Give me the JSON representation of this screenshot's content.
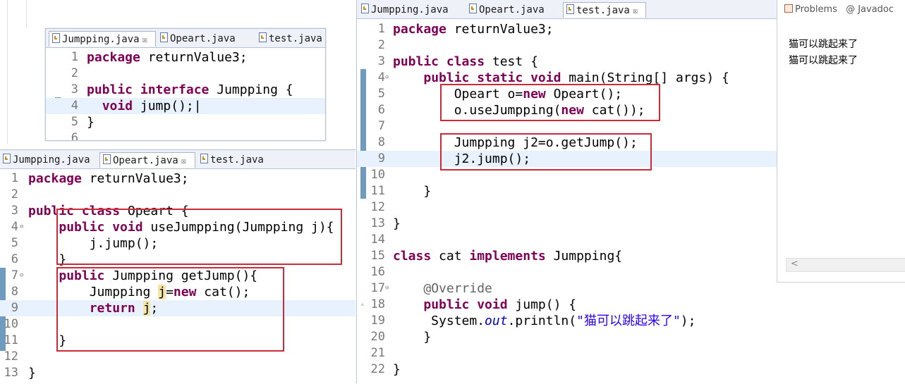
{
  "top_left_editor": {
    "tabs": [
      {
        "label": "Jumpping.java",
        "active": true,
        "close": "☒"
      },
      {
        "label": "Opeart.java",
        "active": false
      },
      {
        "label": "test.java",
        "active": false
      }
    ],
    "lines": [
      {
        "n": "1",
        "h": "<span class=\"kw\">package</span> returnValue3;"
      },
      {
        "n": "2",
        "h": ""
      },
      {
        "n": "3",
        "h": "<span class=\"kw\">public interface</span> Jumpping {"
      },
      {
        "n": "4",
        "h": "  <span class=\"kw\">void</span> jump();|"
      },
      {
        "n": "5",
        "h": "}"
      },
      {
        "n": "6",
        "h": ""
      }
    ]
  },
  "bottom_left_editor": {
    "tabs": [
      {
        "label": "Jumpping.java",
        "active": false
      },
      {
        "label": "Opeart.java",
        "active": true,
        "close": "☒"
      },
      {
        "label": "test.java",
        "active": false
      }
    ],
    "lines": [
      {
        "n": "1",
        "h": "<span class=\"kw\">package</span> returnValue3;"
      },
      {
        "n": "2",
        "h": ""
      },
      {
        "n": "3",
        "h": "<span class=\"kw\">public class</span> Opeart {"
      },
      {
        "n": "4",
        "h": "    <span class=\"kw\">public void</span> useJumpping(Jumpping j){"
      },
      {
        "n": "5",
        "h": "        j.jump();"
      },
      {
        "n": "6",
        "h": "    }"
      },
      {
        "n": "7",
        "h": "    <span class=\"kw\">public</span> Jumpping getJump(){"
      },
      {
        "n": "8",
        "h": "        Jumpping <span class=\"mark\">j</span>=<span class=\"kw\">new</span> cat();"
      },
      {
        "n": "9",
        "h": "        <span class=\"kw\">return</span> <span class=\"mark\">j</span>;"
      },
      {
        "n": "10",
        "h": ""
      },
      {
        "n": "11",
        "h": "    }"
      },
      {
        "n": "12",
        "h": ""
      },
      {
        "n": "13",
        "h": "}"
      }
    ]
  },
  "right_editor": {
    "tabs": [
      {
        "label": "Jumpping.java",
        "active": false
      },
      {
        "label": "Opeart.java",
        "active": false
      },
      {
        "label": "test.java",
        "active": true,
        "close": "☒"
      }
    ],
    "lines": [
      {
        "n": "1",
        "h": "<span class=\"kw\">package</span> returnValue3;"
      },
      {
        "n": "2",
        "h": ""
      },
      {
        "n": "3",
        "h": "<span class=\"kw\">public class</span> test {"
      },
      {
        "n": "4",
        "h": "    <span class=\"kw\">public static void</span> main(String[] args) {"
      },
      {
        "n": "5",
        "h": "        Opeart o=<span class=\"kw\">new</span> Opeart();"
      },
      {
        "n": "6",
        "h": "        o.useJumpping(<span class=\"kw\">new</span> cat());"
      },
      {
        "n": "7",
        "h": ""
      },
      {
        "n": "8",
        "h": "        Jumpping j2=o.getJump();"
      },
      {
        "n": "9",
        "h": "        j2.jump();"
      },
      {
        "n": "10",
        "h": ""
      },
      {
        "n": "11",
        "h": "    }"
      },
      {
        "n": "12",
        "h": ""
      },
      {
        "n": "13",
        "h": "}"
      },
      {
        "n": "14",
        "h": ""
      },
      {
        "n": "15",
        "h": "<span class=\"kw\">class</span> cat <span class=\"kw\">implements</span> Jumpping{"
      },
      {
        "n": "16",
        "h": ""
      },
      {
        "n": "17",
        "h": "    <span class=\"ann\">@Override</span>"
      },
      {
        "n": "18",
        "h": "    <span class=\"kw\">public void</span> jump() {"
      },
      {
        "n": "19",
        "h": "     System.<span class=\"it\">out</span>.println(<span class=\"str\">\"猫可以跳起来了\"</span>);"
      },
      {
        "n": "20",
        "h": "    }"
      },
      {
        "n": "21",
        "h": ""
      },
      {
        "n": "22",
        "h": "}"
      }
    ]
  },
  "console": {
    "tabs": [
      {
        "label": "Problems",
        "icon": "problems-icon"
      },
      {
        "label": "@ Javadoc",
        "icon": "javadoc-icon"
      }
    ],
    "output": [
      "猫可以跳起来了",
      "猫可以跳起来了"
    ],
    "scroll_left_glyph": "<"
  },
  "colors": {
    "keyword": "#7f0055",
    "string": "#2a00ff",
    "annotation": "#646464",
    "highlight_box": "#cc2a36",
    "current_line": "#e8f2fe"
  }
}
